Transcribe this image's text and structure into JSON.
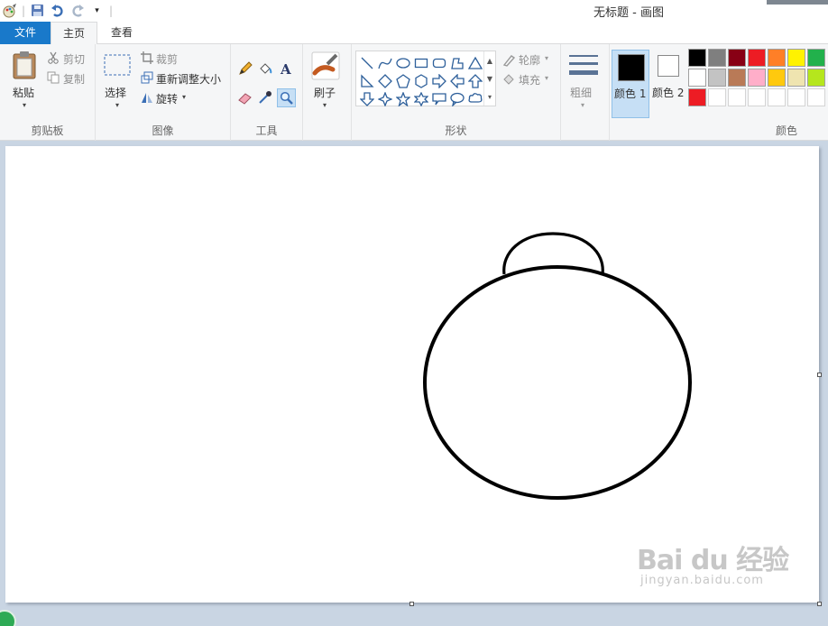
{
  "window": {
    "title": "无标题 - 画图"
  },
  "tabs": {
    "file": "文件",
    "home": "主页",
    "view": "查看"
  },
  "clipboard": {
    "paste": "粘贴",
    "cut": "剪切",
    "copy": "复制",
    "group": "剪贴板"
  },
  "image": {
    "select": "选择",
    "crop": "裁剪",
    "resize": "重新调整大小",
    "rotate": "旋转",
    "group": "图像"
  },
  "tools": {
    "group": "工具"
  },
  "brushes": {
    "label": "刷子"
  },
  "shapes": {
    "outline": "轮廓",
    "fill": "填充",
    "group": "形状"
  },
  "size": {
    "label": "粗细"
  },
  "colors": {
    "color1": "颜色 1",
    "color2": "颜色 2",
    "group": "颜色",
    "color1_value": "#000000",
    "color2_value": "#ffffff",
    "palette": [
      "#000000",
      "#7f7f7f",
      "#880015",
      "#ed1c24",
      "#ff7f27",
      "#fff200",
      "#22b14c",
      "#ffffff",
      "#c3c3c3",
      "#b97a57",
      "#ffaec9",
      "#ffc90e",
      "#efe4b0",
      "#b5e61d",
      "#ed1c24",
      "#ffffff",
      "#ffffff",
      "#ffffff",
      "#ffffff",
      "#ffffff",
      "#ffffff"
    ]
  },
  "watermark": {
    "main": "Bai du 经验",
    "sub": "jingyan.baidu.com"
  }
}
